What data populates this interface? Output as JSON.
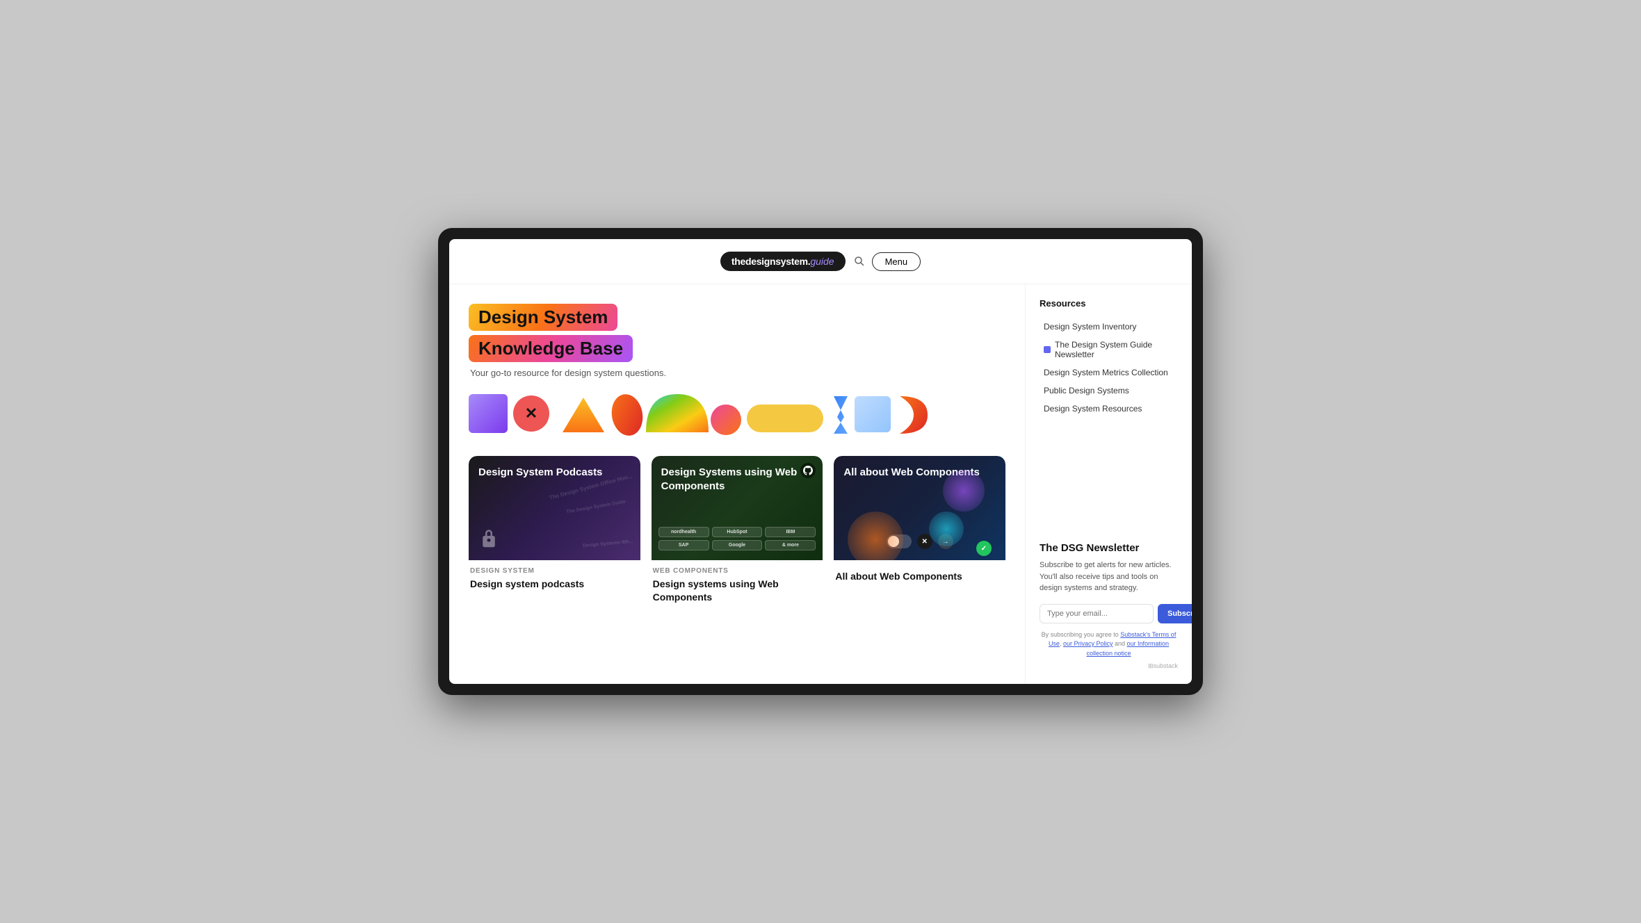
{
  "header": {
    "logo_main": "thedesignsystem.",
    "logo_guide": "guide",
    "menu_label": "Menu"
  },
  "hero": {
    "title_line1": "Design System",
    "title_line2": "Knowledge Base",
    "subtitle": "Your go-to resource for design system questions."
  },
  "sidebar": {
    "resources_title": "Resources",
    "nav_items": [
      {
        "label": "Design System Inventory",
        "dot_color": ""
      },
      {
        "label": "The Design System Guide Newsletter",
        "dot_color": "#6366f1"
      },
      {
        "label": "Design System Metrics Collection",
        "dot_color": ""
      },
      {
        "label": "Public Design Systems",
        "dot_color": ""
      },
      {
        "label": "Design System Resources",
        "dot_color": ""
      }
    ]
  },
  "newsletter": {
    "title": "The DSG Newsletter",
    "description": "Subscribe to get alerts for new articles. You'll also receive tips and tools on design systems and strategy.",
    "email_placeholder": "Type your email...",
    "subscribe_label": "Subscribe",
    "terms_text": "By subscribing you agree to Substack's Terms of Use, our Privacy Policy and our Information collection notice",
    "substack_label": "⊞substack"
  },
  "cards": [
    {
      "id": "podcasts",
      "category": "DESIGN SYSTEM",
      "title": "Design system podcasts",
      "overlay_title": "Design System Podcasts",
      "floating_texts": [
        "The Design System Office Hou...",
        "The Design System Guide",
        "Design Systems Wh..."
      ]
    },
    {
      "id": "webcomponents",
      "category": "WEB COMPONENTS",
      "title": "Design systems using Web Components",
      "overlay_title": "Design Systems using Web Components",
      "logos": [
        "nordhealth",
        "HubSpot",
        "IBM",
        "SAP",
        "Google",
        "& more"
      ]
    },
    {
      "id": "allabout",
      "category": "",
      "title": "All about Web Components",
      "overlay_title": "All about Web Components"
    }
  ]
}
